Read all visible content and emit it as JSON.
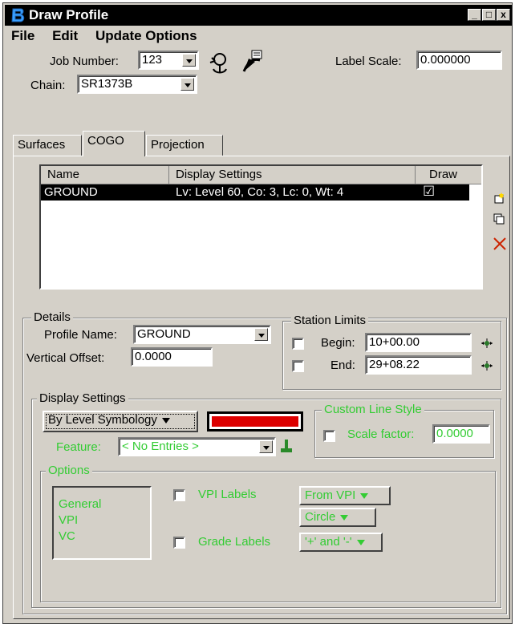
{
  "window": {
    "title": "Draw Profile",
    "minimize": "_",
    "maximize": "□",
    "close": "x"
  },
  "menu": {
    "file": "File",
    "edit": "Edit",
    "update_options": "Update Options"
  },
  "top": {
    "job_number_label": "Job Number:",
    "job_number_value": "123",
    "chain_label": "Chain:",
    "chain_value": "SR1373B",
    "label_scale_label": "Label Scale:",
    "label_scale_value": "0.000000"
  },
  "tabs": [
    "Surfaces",
    "COGO",
    "Projection"
  ],
  "list": {
    "headers": {
      "name": "Name",
      "display": "Display Settings",
      "draw": "Draw"
    },
    "rows": [
      {
        "name": "GROUND",
        "display": "Lv: Level 60, Co: 3, Lc: 0, Wt: 4",
        "draw": "☑"
      }
    ]
  },
  "details": {
    "title": "Details",
    "profile_name_label": "Profile Name:",
    "profile_name_value": "GROUND",
    "vertical_offset_label": "Vertical Offset:",
    "vertical_offset_value": "0.0000",
    "station_limits": {
      "title": "Station Limits",
      "begin_label": "Begin:",
      "begin_value": "10+00.00",
      "end_label": "End:",
      "end_value": "29+08.22"
    }
  },
  "display_settings": {
    "title": "Display Settings",
    "mode": "By Level Symbology",
    "color": "#dd0000",
    "feature_label": "Feature:",
    "feature_value": "< No Entries >",
    "custom_line_style": {
      "title": "Custom Line Style",
      "scale_label": "Scale factor:",
      "scale_value": "0.0000"
    }
  },
  "options": {
    "title": "Options",
    "list": [
      "General",
      "VPI",
      "VC"
    ],
    "vpi_labels": "VPI Labels",
    "vpi_from": "From VPI",
    "vpi_shape": "Circle",
    "grade_labels": "Grade Labels",
    "grade_sign": "'+' and '-'"
  }
}
